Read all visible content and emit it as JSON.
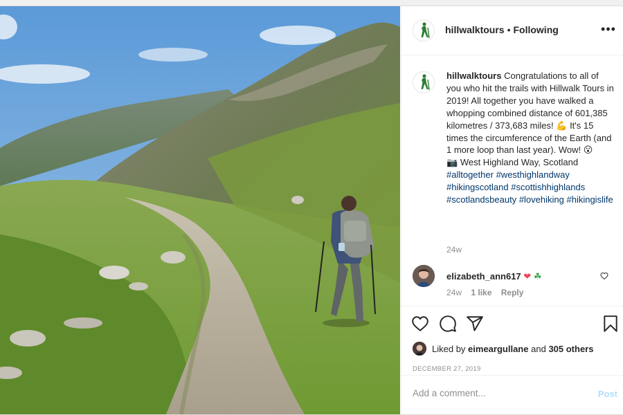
{
  "post": {
    "username": "hillwalktours",
    "separator": "•",
    "follow_status": "Following",
    "more_icon": "ellipsis-icon",
    "avatar_icon": "hiker-icon",
    "photo_alt": "hiker-on-highland-trail-photo"
  },
  "caption": {
    "username": "hillwalktours",
    "text_1": "Congratulations to all of you who hit the trails with Hillwalk Tours in 2019! All together you have walked a whopping combined distance of 601,385 kilometres / 373,683 miles!",
    "emoji_1": "💪",
    "text_2": "It's 15 times the circumference of the Earth (and 1 more loop than last year). Wow!",
    "emoji_2": "😮",
    "camera_emoji": "📷",
    "location": "West Highland Way, Scotland",
    "hashtags": [
      "#alltogether",
      "#westhighlandway",
      "#hikingscotland",
      "#scottishhighlands",
      "#scotlandsbeauty",
      "#lovehiking",
      "#hikingislife"
    ],
    "time": "24w"
  },
  "comment": {
    "username": "elizabeth_ann617",
    "heart": "❤",
    "clover": "☘",
    "time": "24w",
    "likes": "1 like",
    "reply": "Reply"
  },
  "actions": {
    "liked_by_prefix": "Liked by",
    "liked_by_user": "eimeargullane",
    "liked_by_and": "and",
    "liked_by_others": "305 others",
    "date": "December 27, 2019"
  },
  "add_comment": {
    "placeholder": "Add a comment...",
    "post_label": "Post"
  },
  "colors": {
    "link": "#00376b",
    "post_button_disabled": "#b2dffc",
    "heart": "#ed4956",
    "avatar_green": "#2e7d32"
  }
}
